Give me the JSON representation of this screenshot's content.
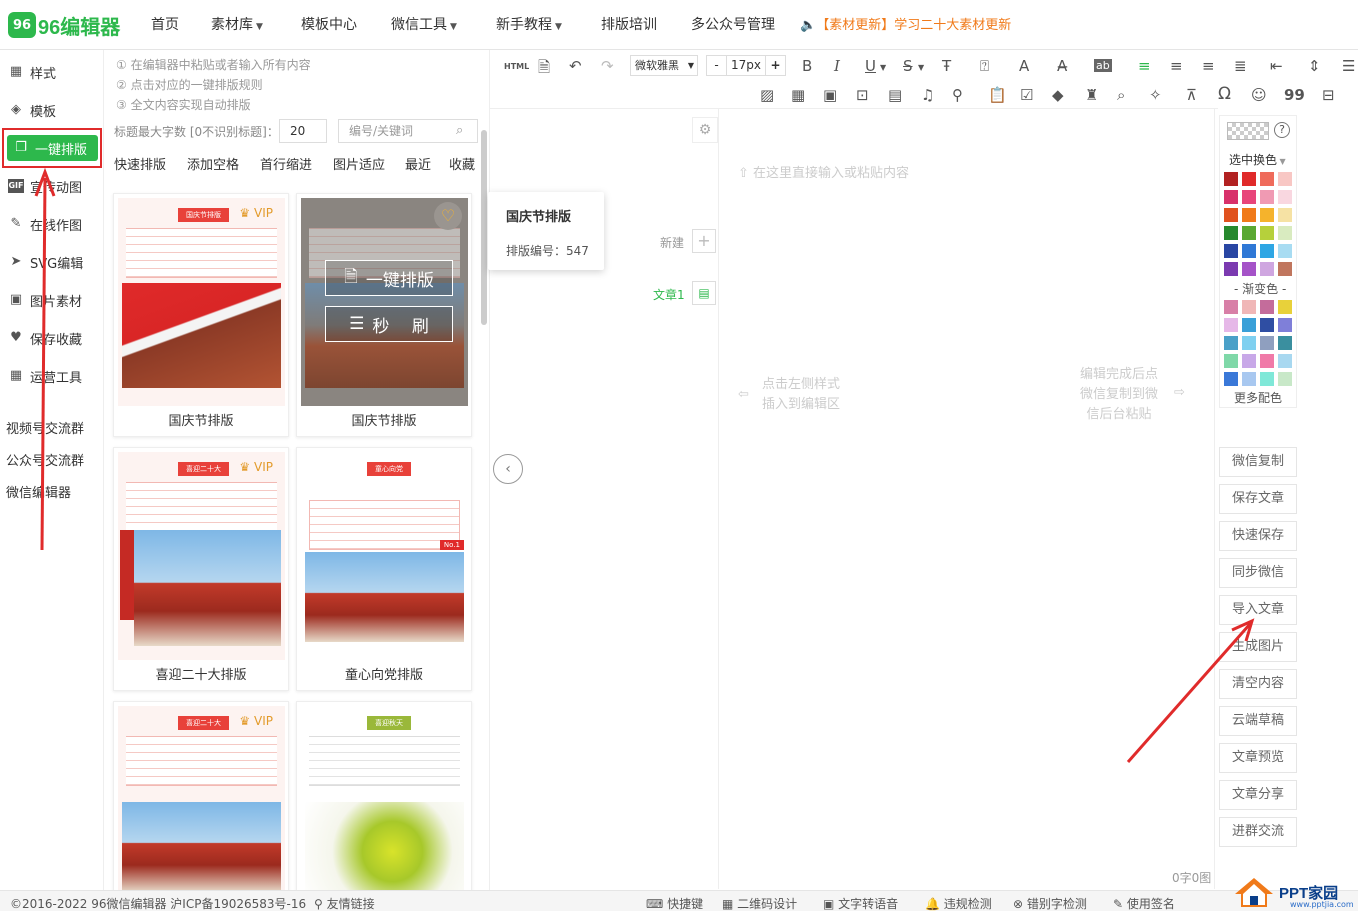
{
  "brand": {
    "logo_mark": "96",
    "logo_text": "96编辑器"
  },
  "nav": {
    "items": [
      {
        "label": "首页"
      },
      {
        "label": "素材库"
      },
      {
        "label": "模板中心"
      },
      {
        "label": "微信工具"
      },
      {
        "label": "新手教程"
      },
      {
        "label": "排版培训"
      },
      {
        "label": "多公众号管理"
      }
    ],
    "announcement": "【素材更新】学习二十大素材更新"
  },
  "sidebar": {
    "items": [
      {
        "label": "样式",
        "icon": "grid-icon"
      },
      {
        "label": "模板",
        "icon": "layers-icon"
      },
      {
        "label": "一键排版",
        "icon": "copy-icon"
      },
      {
        "label": "宣传动图",
        "icon": "gif-icon"
      },
      {
        "label": "在线作图",
        "icon": "pen-icon"
      },
      {
        "label": "SVG编辑",
        "icon": "pointer-icon"
      },
      {
        "label": "图片素材",
        "icon": "image-icon"
      },
      {
        "label": "保存收藏",
        "icon": "heart-icon"
      },
      {
        "label": "运营工具",
        "icon": "tools-icon"
      }
    ],
    "links": [
      {
        "label": "视频号交流群"
      },
      {
        "label": "公众号交流群"
      },
      {
        "label": "微信编辑器"
      }
    ]
  },
  "panel": {
    "tips": [
      "① 在编辑器中粘贴或者输入所有内容",
      "② 点击对应的一键排版规则",
      "③ 全文内容实现自动排版"
    ],
    "maxlen_label": "标题最大字数 [0不识别标题]：",
    "maxlen_value": "20",
    "keyword_placeholder": "编号/关键词",
    "tabs": [
      "快速排版",
      "添加空格",
      "首行缩进",
      "图片适应",
      "最近",
      "收藏"
    ],
    "templates": [
      {
        "title": "国庆节排版",
        "badge": "国庆节排版",
        "vip": "VIP"
      },
      {
        "title": "国庆节排版",
        "overlay_primary": "一键排版",
        "overlay_secondary": "秒　 刷"
      },
      {
        "title": "喜迎二十大排版",
        "badge": "喜迎二十大",
        "vip": "VIP"
      },
      {
        "title": "童心向党排版",
        "badge": "童心向党",
        "tag": "No.1"
      },
      {
        "badge": "喜迎二十大",
        "vip": "VIP"
      },
      {
        "badge": "喜迎秋天"
      }
    ]
  },
  "tooltip": {
    "title": "国庆节排版",
    "code_label": "排版编号：547"
  },
  "toolbar": {
    "font": "微软雅黑",
    "size": "17px",
    "minus": "-",
    "plus": "+",
    "html_label": "HTML",
    "bold": "B",
    "italic": "I",
    "underline": "U",
    "strike": "S",
    "omega": "Ω",
    "quote": "99"
  },
  "editor": {
    "new_label": "新建",
    "article_label": "文章1",
    "placeholder": "在这里直接输入或粘贴内容",
    "hint_left": [
      "点击左侧样式",
      "插入到编辑区"
    ],
    "hint_right": [
      "编辑完成后点",
      "微信复制到微",
      "信后台粘贴"
    ],
    "word_count": "0字0图"
  },
  "colors": {
    "select_label": "选中换色",
    "gradient_label": "- 渐变色 -",
    "more_label": "更多配色",
    "swatches": [
      [
        "#b22222",
        "#e02a2a",
        "#ef6b5b",
        "#f8c7c4"
      ],
      [
        "#d8316b",
        "#e8457a",
        "#f09ab3",
        "#f9d7e0"
      ],
      [
        "#e0521f",
        "#f07a1a",
        "#f5b32c",
        "#f6e2a4"
      ],
      [
        "#27892e",
        "#5aa832",
        "#b6d03b",
        "#d9ebc0"
      ],
      [
        "#2946a3",
        "#2f78d6",
        "#2ea6e4",
        "#a8dcf2"
      ],
      [
        "#7b3ab0",
        "#a553c8",
        "#cfa6e0",
        "#c0765e"
      ]
    ],
    "gradients": [
      [
        "#d87fa7",
        "#f0b7b7",
        "#c46c9b",
        "#e8d13a"
      ],
      [
        "#e6b8e8",
        "#3aa0d8",
        "#2f4ea3",
        "#7f7fd9"
      ],
      [
        "#4aa0c8",
        "#7fd0f0",
        "#8f9fbf",
        "#3a8f9f"
      ],
      [
        "#7fd8a8",
        "#c8a8e8",
        "#f07aa8",
        "#a8d8f0"
      ],
      [
        "#3a78d8",
        "#a8c8f0",
        "#7fe8d8",
        "#c8e8c8"
      ]
    ]
  },
  "actions": [
    "微信复制",
    "保存文章",
    "快速保存",
    "同步微信",
    "导入文章",
    "生成图片",
    "清空内容",
    "云端草稿",
    "文章预览",
    "文章分享",
    "进群交流"
  ],
  "footer": {
    "copyright": "©2016-2022 96微信编辑器 沪ICP备19026583号-16",
    "friend_link": "友情链接",
    "tools": [
      "快捷键",
      "二维码设计",
      "文字转语音",
      "违规检测",
      "错别字检测",
      "使用签名"
    ]
  },
  "watermark": {
    "brand": "PPT家园",
    "site": "www.pptjia.com"
  },
  "accent": {
    "green": "#2db84c",
    "annotation": "#e02b2b",
    "orange": "#f07a1a"
  }
}
